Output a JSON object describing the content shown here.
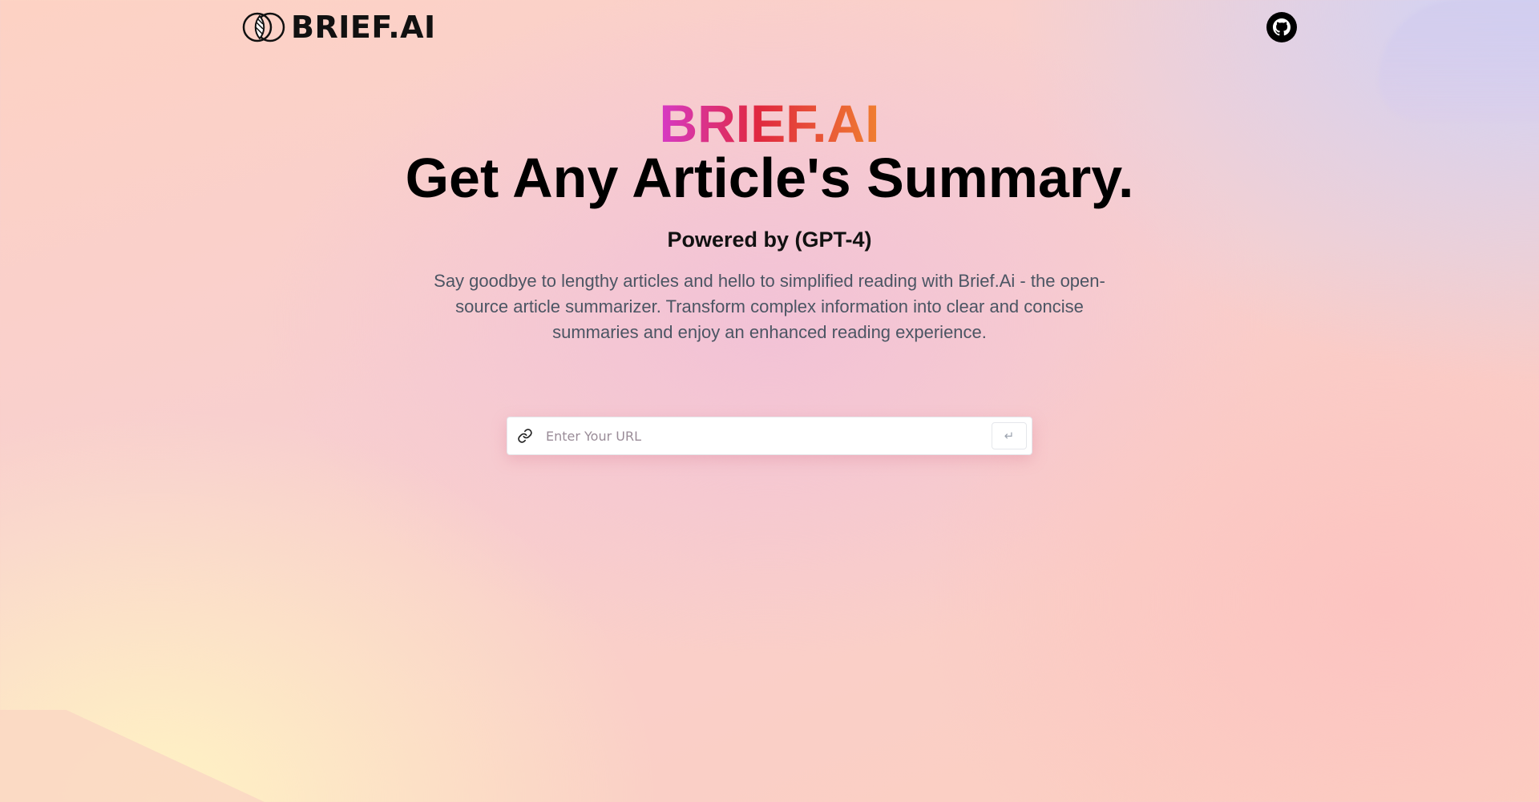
{
  "navbar": {
    "brand_text": "BRIEF.AI",
    "github_icon": "github-icon"
  },
  "hero": {
    "brand": "BRIEF.AI",
    "title": "Get Any Article's Summary.",
    "powered_by": "Powered by (GPT-4)",
    "description": "Say goodbye to lengthy articles and hello to simplified reading with Brief.Ai - the open-source article summarizer. Transform complex information into clear and concise summaries and enjoy an enhanced reading experience."
  },
  "search": {
    "placeholder": "Enter Your URL",
    "value": "",
    "submit_label": "↵",
    "icon": "link-icon"
  },
  "colors": {
    "brand_gradient_start": "#d63ac7",
    "brand_gradient_mid": "#e0283f",
    "brand_gradient_end": "#f08030"
  }
}
